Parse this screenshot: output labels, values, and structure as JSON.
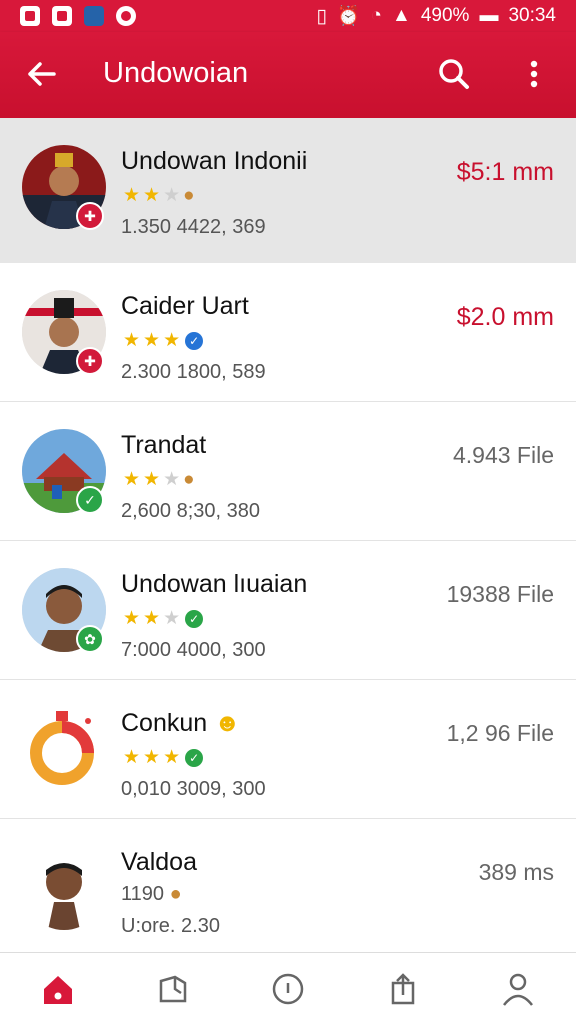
{
  "status_bar": {
    "battery": "490%",
    "time": "30:34"
  },
  "app_bar": {
    "title": "Undowoian"
  },
  "items": [
    {
      "name": "Undowan Indonii",
      "stats": "1.350   4422, 369",
      "amount": "$5:1 mm",
      "stars": 2,
      "selected": true
    },
    {
      "name": "Caider Uart",
      "stats": "2.300   1800, 589",
      "amount": "$2.0 mm",
      "stars": 3
    },
    {
      "name": "Trandat",
      "stats": "2,600   8;30, 380",
      "amount": "4.943 File",
      "stars": 2
    },
    {
      "name": "Undowan lıuaian",
      "stats": "7:000   4000, 300",
      "amount": "19388 File",
      "stars": 2
    },
    {
      "name": "Conkun",
      "stats": "0,010   3009, 300",
      "amount": "1,2 96 File",
      "stars": 3
    },
    {
      "name": "Valdoa",
      "stats": "1190",
      "stats2": "U:ore. 2.30",
      "amount": "389 ms"
    }
  ],
  "bottom_nav": [
    "home-icon",
    "document-icon",
    "compass-icon",
    "share-icon",
    "profile-icon"
  ],
  "colors": {
    "accent": "#d8183a",
    "star": "#f1b600"
  }
}
